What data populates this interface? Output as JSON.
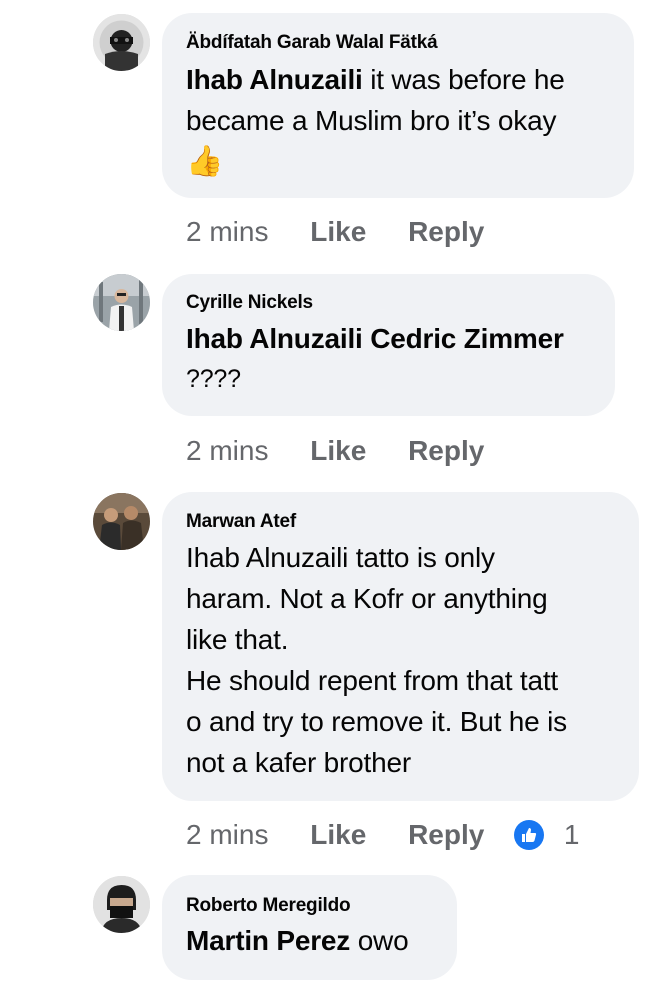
{
  "comments": [
    {
      "author": "Äbdífatah Garab Walal Fätká",
      "mention": "Ihab Alnuzaili",
      "text_lines": [
        " it was before he",
        "became a Muslim bro it’s okay"
      ],
      "emoji": "👍",
      "emoji_name": "thumbs-up",
      "time": "2 mins",
      "like_label": "Like",
      "reply_label": "Reply"
    },
    {
      "author": "Cyrille Nickels",
      "mention": "Ihab Alnuzaili Cedric Zimmer",
      "text_lines": [
        "????"
      ],
      "time": "2 mins",
      "like_label": "Like",
      "reply_label": "Reply"
    },
    {
      "author": "Marwan Atef",
      "text_lines": [
        "Ihab Alnuzaili tatto is only",
        "haram. Not a Kofr or anything",
        "like that.",
        "He should repent from that tatt",
        "o and try to remove it. But he is",
        "not a kafer brother"
      ],
      "time": "2 mins",
      "like_label": "Like",
      "reply_label": "Reply",
      "reaction_count": "1",
      "reaction_icon": "like-reaction-icon"
    },
    {
      "author": "Roberto Meregildo",
      "mention": "Martin Perez",
      "text_after": " owo"
    }
  ],
  "colors": {
    "bubble": "#f0f2f5",
    "secondary_text": "#65676b",
    "reaction_blue": "#1877f2"
  }
}
